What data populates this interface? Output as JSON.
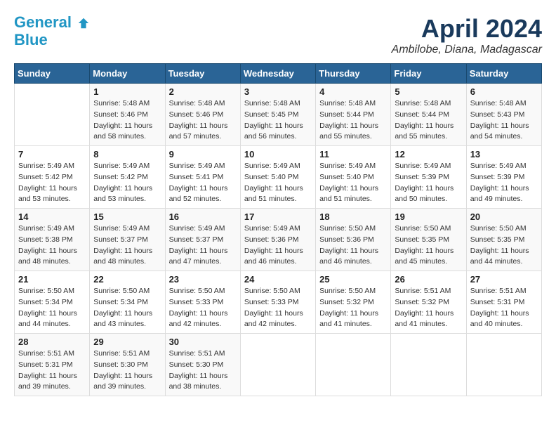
{
  "logo": {
    "line1": "General",
    "line2": "Blue"
  },
  "title": "April 2024",
  "location": "Ambilobe, Diana, Madagascar",
  "weekdays": [
    "Sunday",
    "Monday",
    "Tuesday",
    "Wednesday",
    "Thursday",
    "Friday",
    "Saturday"
  ],
  "weeks": [
    [
      {
        "day": "",
        "sunrise": "",
        "sunset": "",
        "daylight": ""
      },
      {
        "day": "1",
        "sunrise": "Sunrise: 5:48 AM",
        "sunset": "Sunset: 5:46 PM",
        "daylight": "Daylight: 11 hours and 58 minutes."
      },
      {
        "day": "2",
        "sunrise": "Sunrise: 5:48 AM",
        "sunset": "Sunset: 5:46 PM",
        "daylight": "Daylight: 11 hours and 57 minutes."
      },
      {
        "day": "3",
        "sunrise": "Sunrise: 5:48 AM",
        "sunset": "Sunset: 5:45 PM",
        "daylight": "Daylight: 11 hours and 56 minutes."
      },
      {
        "day": "4",
        "sunrise": "Sunrise: 5:48 AM",
        "sunset": "Sunset: 5:44 PM",
        "daylight": "Daylight: 11 hours and 55 minutes."
      },
      {
        "day": "5",
        "sunrise": "Sunrise: 5:48 AM",
        "sunset": "Sunset: 5:44 PM",
        "daylight": "Daylight: 11 hours and 55 minutes."
      },
      {
        "day": "6",
        "sunrise": "Sunrise: 5:48 AM",
        "sunset": "Sunset: 5:43 PM",
        "daylight": "Daylight: 11 hours and 54 minutes."
      }
    ],
    [
      {
        "day": "7",
        "sunrise": "Sunrise: 5:49 AM",
        "sunset": "Sunset: 5:42 PM",
        "daylight": "Daylight: 11 hours and 53 minutes."
      },
      {
        "day": "8",
        "sunrise": "Sunrise: 5:49 AM",
        "sunset": "Sunset: 5:42 PM",
        "daylight": "Daylight: 11 hours and 53 minutes."
      },
      {
        "day": "9",
        "sunrise": "Sunrise: 5:49 AM",
        "sunset": "Sunset: 5:41 PM",
        "daylight": "Daylight: 11 hours and 52 minutes."
      },
      {
        "day": "10",
        "sunrise": "Sunrise: 5:49 AM",
        "sunset": "Sunset: 5:40 PM",
        "daylight": "Daylight: 11 hours and 51 minutes."
      },
      {
        "day": "11",
        "sunrise": "Sunrise: 5:49 AM",
        "sunset": "Sunset: 5:40 PM",
        "daylight": "Daylight: 11 hours and 51 minutes."
      },
      {
        "day": "12",
        "sunrise": "Sunrise: 5:49 AM",
        "sunset": "Sunset: 5:39 PM",
        "daylight": "Daylight: 11 hours and 50 minutes."
      },
      {
        "day": "13",
        "sunrise": "Sunrise: 5:49 AM",
        "sunset": "Sunset: 5:39 PM",
        "daylight": "Daylight: 11 hours and 49 minutes."
      }
    ],
    [
      {
        "day": "14",
        "sunrise": "Sunrise: 5:49 AM",
        "sunset": "Sunset: 5:38 PM",
        "daylight": "Daylight: 11 hours and 48 minutes."
      },
      {
        "day": "15",
        "sunrise": "Sunrise: 5:49 AM",
        "sunset": "Sunset: 5:37 PM",
        "daylight": "Daylight: 11 hours and 48 minutes."
      },
      {
        "day": "16",
        "sunrise": "Sunrise: 5:49 AM",
        "sunset": "Sunset: 5:37 PM",
        "daylight": "Daylight: 11 hours and 47 minutes."
      },
      {
        "day": "17",
        "sunrise": "Sunrise: 5:49 AM",
        "sunset": "Sunset: 5:36 PM",
        "daylight": "Daylight: 11 hours and 46 minutes."
      },
      {
        "day": "18",
        "sunrise": "Sunrise: 5:50 AM",
        "sunset": "Sunset: 5:36 PM",
        "daylight": "Daylight: 11 hours and 46 minutes."
      },
      {
        "day": "19",
        "sunrise": "Sunrise: 5:50 AM",
        "sunset": "Sunset: 5:35 PM",
        "daylight": "Daylight: 11 hours and 45 minutes."
      },
      {
        "day": "20",
        "sunrise": "Sunrise: 5:50 AM",
        "sunset": "Sunset: 5:35 PM",
        "daylight": "Daylight: 11 hours and 44 minutes."
      }
    ],
    [
      {
        "day": "21",
        "sunrise": "Sunrise: 5:50 AM",
        "sunset": "Sunset: 5:34 PM",
        "daylight": "Daylight: 11 hours and 44 minutes."
      },
      {
        "day": "22",
        "sunrise": "Sunrise: 5:50 AM",
        "sunset": "Sunset: 5:34 PM",
        "daylight": "Daylight: 11 hours and 43 minutes."
      },
      {
        "day": "23",
        "sunrise": "Sunrise: 5:50 AM",
        "sunset": "Sunset: 5:33 PM",
        "daylight": "Daylight: 11 hours and 42 minutes."
      },
      {
        "day": "24",
        "sunrise": "Sunrise: 5:50 AM",
        "sunset": "Sunset: 5:33 PM",
        "daylight": "Daylight: 11 hours and 42 minutes."
      },
      {
        "day": "25",
        "sunrise": "Sunrise: 5:50 AM",
        "sunset": "Sunset: 5:32 PM",
        "daylight": "Daylight: 11 hours and 41 minutes."
      },
      {
        "day": "26",
        "sunrise": "Sunrise: 5:51 AM",
        "sunset": "Sunset: 5:32 PM",
        "daylight": "Daylight: 11 hours and 41 minutes."
      },
      {
        "day": "27",
        "sunrise": "Sunrise: 5:51 AM",
        "sunset": "Sunset: 5:31 PM",
        "daylight": "Daylight: 11 hours and 40 minutes."
      }
    ],
    [
      {
        "day": "28",
        "sunrise": "Sunrise: 5:51 AM",
        "sunset": "Sunset: 5:31 PM",
        "daylight": "Daylight: 11 hours and 39 minutes."
      },
      {
        "day": "29",
        "sunrise": "Sunrise: 5:51 AM",
        "sunset": "Sunset: 5:30 PM",
        "daylight": "Daylight: 11 hours and 39 minutes."
      },
      {
        "day": "30",
        "sunrise": "Sunrise: 5:51 AM",
        "sunset": "Sunset: 5:30 PM",
        "daylight": "Daylight: 11 hours and 38 minutes."
      },
      {
        "day": "",
        "sunrise": "",
        "sunset": "",
        "daylight": ""
      },
      {
        "day": "",
        "sunrise": "",
        "sunset": "",
        "daylight": ""
      },
      {
        "day": "",
        "sunrise": "",
        "sunset": "",
        "daylight": ""
      },
      {
        "day": "",
        "sunrise": "",
        "sunset": "",
        "daylight": ""
      }
    ]
  ]
}
